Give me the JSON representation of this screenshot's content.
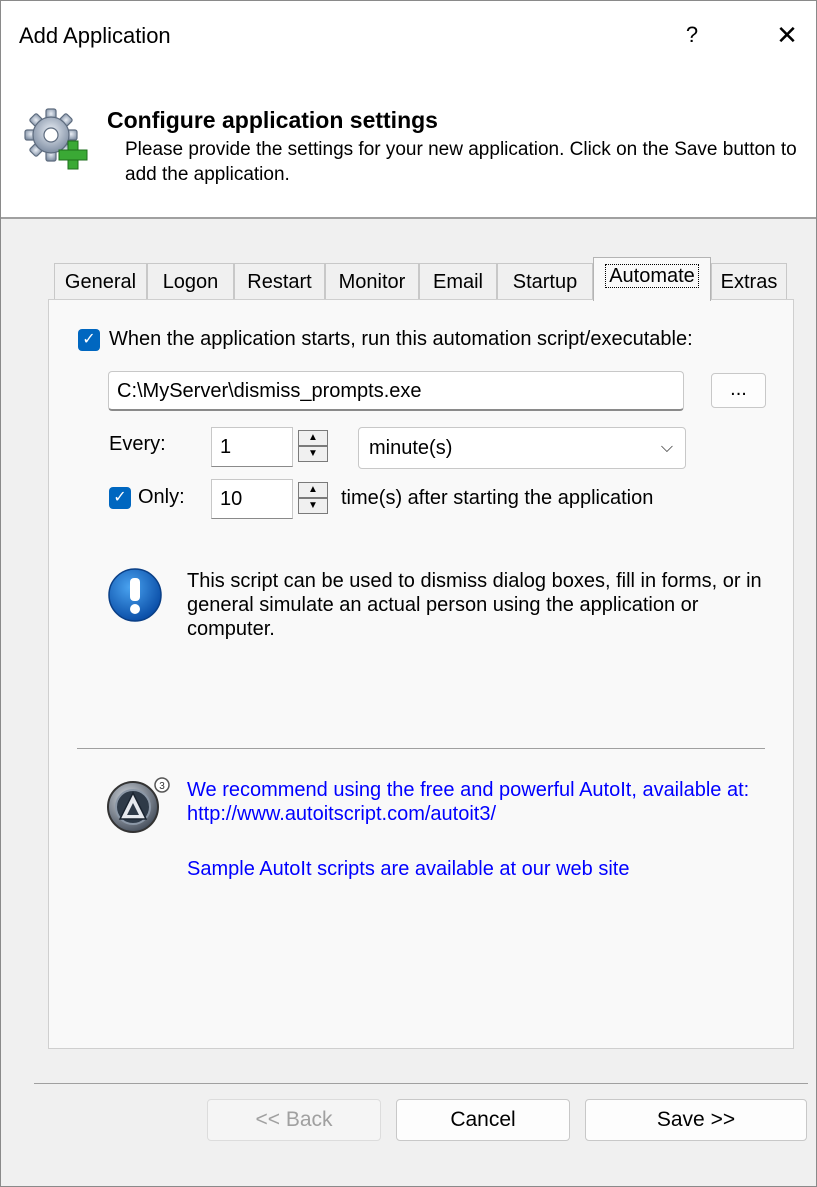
{
  "window": {
    "title": "Add Application",
    "help_label": "?",
    "close_label": "✕"
  },
  "header": {
    "title": "Configure application settings",
    "description": "Please provide the settings for your new application. Click on the Save button to add the application."
  },
  "tabs": [
    {
      "label": "General"
    },
    {
      "label": "Logon"
    },
    {
      "label": "Restart"
    },
    {
      "label": "Monitor"
    },
    {
      "label": "Email"
    },
    {
      "label": "Startup"
    },
    {
      "label": "Automate",
      "active": true
    },
    {
      "label": "Extras"
    }
  ],
  "automate": {
    "run_checkbox_checked": true,
    "run_checkbox_label": "When the application starts, run this automation script/executable:",
    "script_path": "C:\\MyServer\\dismiss_prompts.exe",
    "browse_label": "...",
    "every_label": "Every:",
    "every_value": "1",
    "interval_unit": "minute(s)",
    "only_checked": true,
    "only_label": "Only:",
    "only_value": "10",
    "times_label": "time(s) after starting the application",
    "info_text": "This script can be used to dismiss dialog boxes, fill in forms, or in general simulate an actual person using the application or computer.",
    "autoit_recommend": "We recommend using the free and powerful AutoIt, available at: http://www.autoitscript.com/autoit3/",
    "autoit_samples": "Sample AutoIt scripts are available at our web site"
  },
  "footer": {
    "back_label": "<< Back",
    "cancel_label": "Cancel",
    "save_label": "Save >>"
  },
  "icons": {
    "header": "gear-add-icon",
    "info": "exclamation-info-icon",
    "autoit": "autoit-logo-icon"
  },
  "colors": {
    "accent": "#0067c0",
    "link": "#0000ff",
    "info_blue": "#1565c0"
  }
}
